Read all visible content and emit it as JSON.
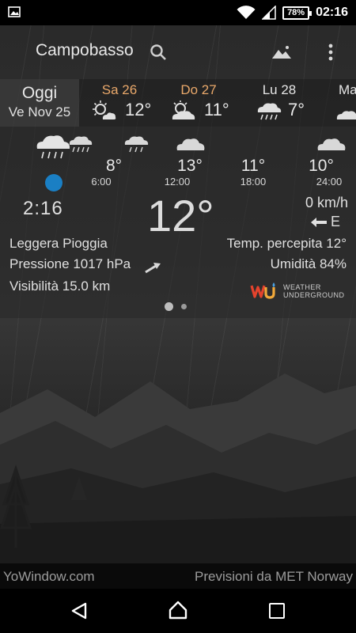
{
  "status_bar": {
    "battery": "78%",
    "time": "02:16",
    "icons": [
      "image-icon",
      "wifi-icon",
      "signal-icon",
      "battery-icon"
    ]
  },
  "header": {
    "city": "Campobasso",
    "icons": [
      "search-icon",
      "landscape-icon",
      "more-vert-icon"
    ]
  },
  "forecast_days": [
    {
      "name": "Oggi",
      "date": "Ve Nov 25"
    },
    {
      "name": "Sa 26",
      "temp": "12°",
      "icon": "partly-sunny-icon",
      "color": "#e9a86a"
    },
    {
      "name": "Do 27",
      "temp": "11°",
      "icon": "partly-sunny-icon",
      "color": "#e9a86a"
    },
    {
      "name": "Lu 28",
      "temp": "7°",
      "icon": "rain-cloud-icon",
      "color": "#e6e6e6"
    },
    {
      "name": "Ma",
      "icon": "partly-sunny-icon",
      "color": "#e6e6e6"
    }
  ],
  "hourly": [
    {
      "temp": "8°",
      "time": "6:00"
    },
    {
      "temp": "13°",
      "time": "12:00"
    },
    {
      "temp": "11°",
      "time": "18:00"
    },
    {
      "temp": "10°",
      "time": "24:00"
    }
  ],
  "current": {
    "time": "2:16",
    "temperature": "12°",
    "wind_speed": "0 km/h",
    "wind_direction": "E",
    "condition": "Leggera Pioggia",
    "pressure": "Pressione 1017 hPa",
    "visibility": "Visibilità 15.0 km",
    "feels_like": "Temp. percepita 12°",
    "humidity": "Umidità 84%"
  },
  "provider_logo": {
    "line1": "WEATHER",
    "line2": "UNDERGROUND"
  },
  "footer": {
    "left": "YoWindow.com",
    "right": "Previsioni da MET Norway"
  },
  "accent_colors": {
    "weekend_day": "#e9a86a",
    "sun_dot": "#1a7fc4"
  }
}
